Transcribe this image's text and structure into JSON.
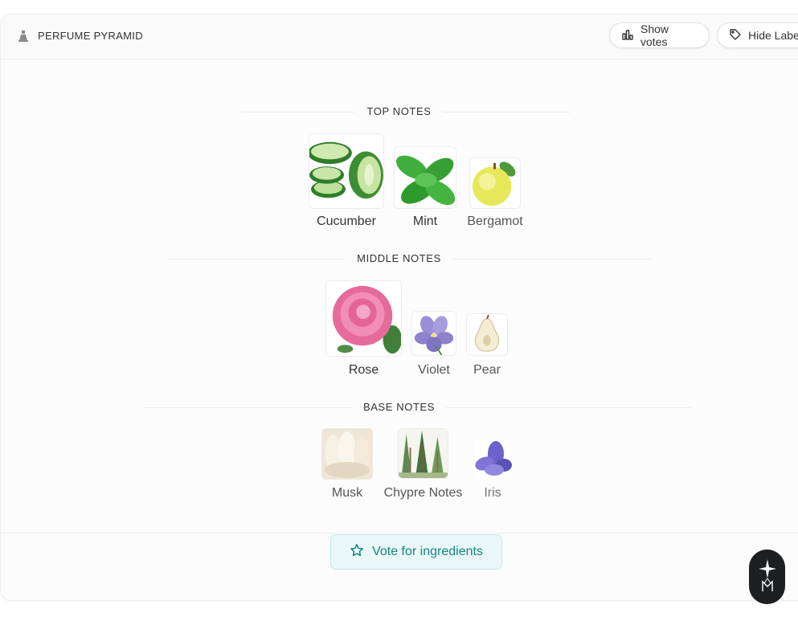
{
  "header": {
    "title": "PERFUME PYRAMID",
    "icon": "perfume-bottle-icon",
    "show_votes_label": "Show votes",
    "hide_labels_label": "Hide Labels"
  },
  "sections": {
    "top": {
      "title": "TOP NOTES",
      "notes": [
        "Cucumber",
        "Mint",
        "Bergamot"
      ]
    },
    "middle": {
      "title": "MIDDLE NOTES",
      "notes": [
        "Rose",
        "Violet",
        "Pear"
      ]
    },
    "base": {
      "title": "BASE NOTES",
      "notes": [
        "Musk",
        "Chypre Notes",
        "Iris"
      ]
    }
  },
  "footer": {
    "vote_label": "Vote for ingredients",
    "vote_icon": "star-icon"
  },
  "colors": {
    "accent": "#13857f",
    "accent_bg": "#e9f8f7",
    "assistant_bg": "#1d1f22"
  },
  "assistant": {
    "icon": "assistant-logo-icon"
  }
}
